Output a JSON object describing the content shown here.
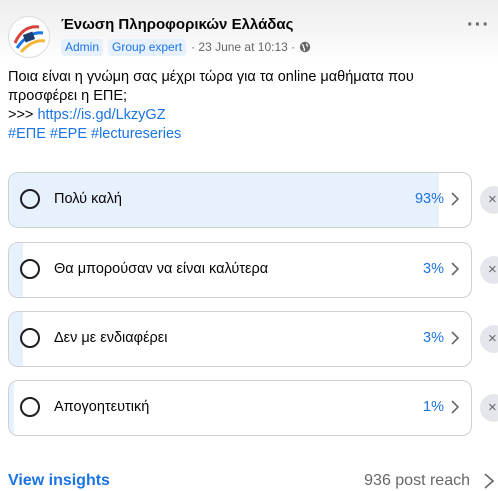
{
  "post": {
    "group_name": "Ένωση Πληροφορικών Ελλάδας",
    "badges": [
      "Admin",
      "Group expert"
    ],
    "timestamp": "· 23 June at 10:13 ·",
    "privacy_icon": "globe-icon",
    "more_label": "···",
    "body_lines": [
      "Ποια είναι η γνώμη σας μέχρι τώρα για τα online μαθήματα που",
      "προσφέρει η ΕΠΕ;"
    ],
    "link_prefix": ">>> ",
    "link": "https://is.gd/LkzyGZ",
    "hashtags": "#ΕΠΕ #EPE #lectureseries"
  },
  "poll": {
    "options": [
      {
        "label": "Πολύ καλή",
        "percent": "93%",
        "fill": 0.93
      },
      {
        "label": "Θα μπορούσαν να είναι καλύτερα",
        "percent": "3%",
        "fill": 0.03
      },
      {
        "label": "Δεν με ενδιαφέρει",
        "percent": "3%",
        "fill": 0.03
      },
      {
        "label": "Απογοητευτική",
        "percent": "1%",
        "fill": 0.01
      }
    ],
    "remove_label": "×"
  },
  "footer": {
    "insights_label": "View insights",
    "reach_label": "936 post reach"
  },
  "colors": {
    "accent": "#1b74e4",
    "bar_fill": "#e7f0fd",
    "text": "#050505",
    "secondary_text": "#65676b"
  }
}
